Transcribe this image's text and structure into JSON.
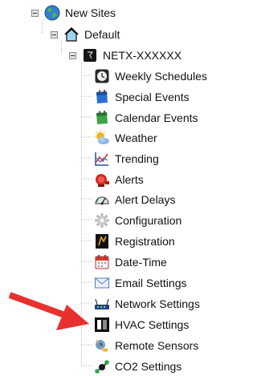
{
  "tree": {
    "root": {
      "label": "New Sites",
      "icon": "globe-icon",
      "expanded": true
    },
    "group": {
      "label": "Default",
      "icon": "house-icon",
      "expanded": true
    },
    "device": {
      "label": "NETX-XXXXXX",
      "icon": "device-icon",
      "expanded": true
    },
    "items": [
      {
        "label": "Weekly Schedules",
        "icon": "clock-icon"
      },
      {
        "label": "Special Events",
        "icon": "blue-calendar-icon"
      },
      {
        "label": "Calendar Events",
        "icon": "green-calendar-icon"
      },
      {
        "label": "Weather",
        "icon": "sun-cloud-icon"
      },
      {
        "label": "Trending",
        "icon": "trend-chart-icon"
      },
      {
        "label": "Alerts",
        "icon": "alarm-bell-icon"
      },
      {
        "label": "Alert Delays",
        "icon": "gauge-icon"
      },
      {
        "label": "Configuration",
        "icon": "gear-icon"
      },
      {
        "label": "Registration",
        "icon": "registration-icon"
      },
      {
        "label": "Date-Time",
        "icon": "date-time-icon"
      },
      {
        "label": "Email Settings",
        "icon": "envelope-icon"
      },
      {
        "label": "Network Settings",
        "icon": "router-icon"
      },
      {
        "label": "HVAC Settings",
        "icon": "hvac-icon"
      },
      {
        "label": "Remote Sensors",
        "icon": "remote-sensor-icon"
      },
      {
        "label": "CO2 Settings",
        "icon": "co2-icon"
      }
    ]
  },
  "annotation": {
    "icon": "red-arrow-icon",
    "color": "#e8312f",
    "points_to": "HVAC Settings"
  }
}
